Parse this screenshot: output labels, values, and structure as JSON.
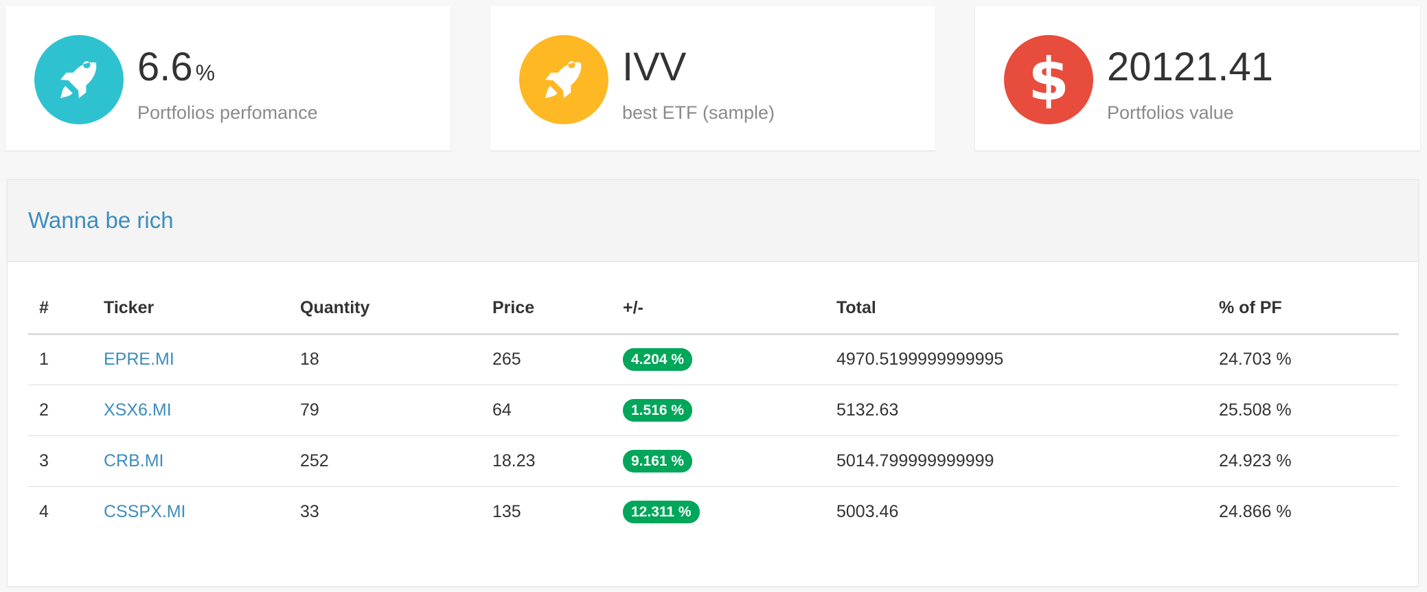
{
  "stats": [
    {
      "number": "6.6",
      "unit": "%",
      "label": "Portfolios perfomance",
      "icon": "rocket-icon",
      "color": "#2ec2d0"
    },
    {
      "number": "IVV",
      "unit": "",
      "label": "best ETF (sample)",
      "icon": "rocket-icon",
      "color": "#fdb824"
    },
    {
      "number": "20121.41",
      "unit": "",
      "label": "Portfolios value",
      "icon": "dollar-icon",
      "color": "#e74c3c",
      "icon_glyph": "$"
    }
  ],
  "panel": {
    "title": "Wanna be rich",
    "columns": [
      "#",
      "Ticker",
      "Quantity",
      "Price",
      "+/-",
      "Total",
      "% of PF"
    ],
    "rows": [
      {
        "index": "1",
        "ticker": "EPRE.MI",
        "quantity": "18",
        "price": "265",
        "change": "4.204 %",
        "total": "4970.5199999999995",
        "pct": "24.703 %"
      },
      {
        "index": "2",
        "ticker": "XSX6.MI",
        "quantity": "79",
        "price": "64",
        "change": "1.516 %",
        "total": "5132.63",
        "pct": "25.508 %"
      },
      {
        "index": "3",
        "ticker": "CRB.MI",
        "quantity": "252",
        "price": "18.23",
        "change": "9.161 %",
        "total": "5014.799999999999",
        "pct": "24.923 %"
      },
      {
        "index": "4",
        "ticker": "CSSPX.MI",
        "quantity": "33",
        "price": "135",
        "change": "12.311 %",
        "total": "5003.46",
        "pct": "24.866 %"
      }
    ]
  },
  "colors": {
    "link": "#3c8dbc",
    "badge": "#00a65a"
  }
}
